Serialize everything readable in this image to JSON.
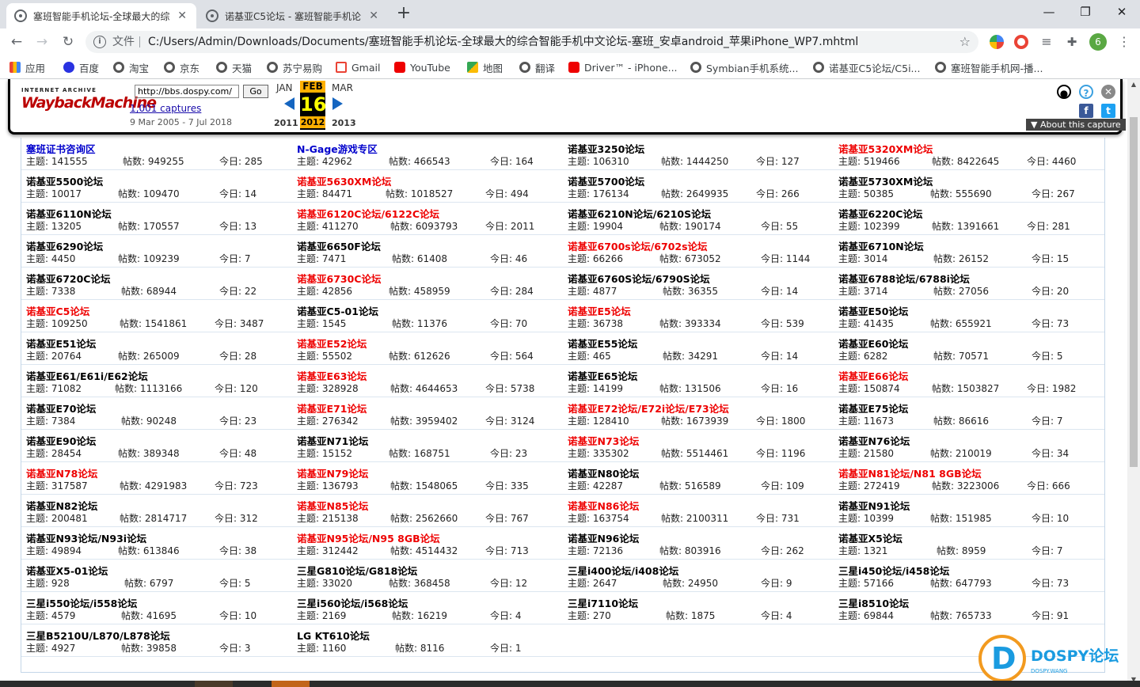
{
  "browser": {
    "tabs": [
      {
        "title": "塞班智能手机论坛-全球最大的综",
        "active": true
      },
      {
        "title": "诺基亚C5论坛 - 塞班智能手机论",
        "active": false
      }
    ],
    "address_prefix": "文件",
    "address": "C:/Users/Admin/Downloads/Documents/塞班智能手机论坛-全球最大的综合智能手机中文论坛-塞班_安卓android_苹果iPhone_WP7.mhtml",
    "profile_initial": "6",
    "bookmarks": [
      "应用",
      "百度",
      "淘宝",
      "京东",
      "天猫",
      "苏宁易购",
      "Gmail",
      "YouTube",
      "地图",
      "翻译",
      "Driver™ - iPhone...",
      "Symbian手机系统...",
      "诺基亚C5论坛/C5i...",
      "塞班智能手机网-播..."
    ]
  },
  "wayback": {
    "logo_top": "INTERNET ARCHIVE",
    "logo_main": "WaybackMachine",
    "url_value": "http://bbs.dospy.com/",
    "go_label": "Go",
    "captures": "1,001 captures",
    "range": "9 Mar 2005 - 7 Jul 2018",
    "prev_month": "JAN",
    "cur_month": "FEB",
    "next_month": "MAR",
    "day": "16",
    "prev_year": "2011",
    "cur_year": "2012",
    "next_year": "2013",
    "about": "▼ About this capture"
  },
  "stat_labels": {
    "topics": "主题:",
    "posts": "帖数:",
    "today": "今日:"
  },
  "forums": [
    [
      {
        "name": "塞班证书咨询区",
        "color": "blue",
        "topics": "141555",
        "posts": "949255",
        "today": "285"
      },
      {
        "name": "N-Gage游戏专区",
        "color": "blue",
        "topics": "42962",
        "posts": "466543",
        "today": "164"
      },
      {
        "name": "诺基亚3250论坛",
        "color": "black",
        "topics": "106310",
        "posts": "1444250",
        "today": "127"
      },
      {
        "name": "诺基亚5320XM论坛",
        "color": "red",
        "topics": "519466",
        "posts": "8422645",
        "today": "4460"
      }
    ],
    [
      {
        "name": "诺基亚5500论坛",
        "color": "black",
        "topics": "10017",
        "posts": "109470",
        "today": "14"
      },
      {
        "name": "诺基亚5630XM论坛",
        "color": "red",
        "topics": "84471",
        "posts": "1018527",
        "today": "494"
      },
      {
        "name": "诺基亚5700论坛",
        "color": "black",
        "topics": "176134",
        "posts": "2649935",
        "today": "266"
      },
      {
        "name": "诺基亚5730XM论坛",
        "color": "black",
        "topics": "50385",
        "posts": "555690",
        "today": "267"
      }
    ],
    [
      {
        "name": "诺基亚6110N论坛",
        "color": "black",
        "topics": "13205",
        "posts": "170557",
        "today": "13"
      },
      {
        "name": "诺基亚6120C论坛/6122C论坛",
        "color": "red",
        "topics": "411270",
        "posts": "6093793",
        "today": "2011"
      },
      {
        "name": "诺基亚6210N论坛/6210S论坛",
        "color": "black",
        "topics": "19904",
        "posts": "190174",
        "today": "55"
      },
      {
        "name": "诺基亚6220C论坛",
        "color": "black",
        "topics": "102399",
        "posts": "1391661",
        "today": "281"
      }
    ],
    [
      {
        "name": "诺基亚6290论坛",
        "color": "black",
        "topics": "4450",
        "posts": "109239",
        "today": "7"
      },
      {
        "name": "诺基亚6650F论坛",
        "color": "black",
        "topics": "7471",
        "posts": "61408",
        "today": "46"
      },
      {
        "name": "诺基亚6700s论坛/6702s论坛",
        "color": "red",
        "topics": "66266",
        "posts": "673052",
        "today": "1144"
      },
      {
        "name": "诺基亚6710N论坛",
        "color": "black",
        "topics": "3014",
        "posts": "26152",
        "today": "15"
      }
    ],
    [
      {
        "name": "诺基亚6720C论坛",
        "color": "black",
        "topics": "7338",
        "posts": "68944",
        "today": "22"
      },
      {
        "name": "诺基亚6730C论坛",
        "color": "red",
        "topics": "42856",
        "posts": "458959",
        "today": "284"
      },
      {
        "name": "诺基亚6760S论坛/6790S论坛",
        "color": "black",
        "topics": "4877",
        "posts": "36355",
        "today": "14"
      },
      {
        "name": "诺基亚6788论坛/6788i论坛",
        "color": "black",
        "topics": "3714",
        "posts": "27056",
        "today": "20"
      }
    ],
    [
      {
        "name": "诺基亚C5论坛",
        "color": "red",
        "topics": "109250",
        "posts": "1541861",
        "today": "3487"
      },
      {
        "name": "诺基亚C5-01论坛",
        "color": "black",
        "topics": "1545",
        "posts": "11376",
        "today": "70"
      },
      {
        "name": "诺基亚E5论坛",
        "color": "red",
        "topics": "36738",
        "posts": "393334",
        "today": "539"
      },
      {
        "name": "诺基亚E50论坛",
        "color": "black",
        "topics": "41435",
        "posts": "655921",
        "today": "73"
      }
    ],
    [
      {
        "name": "诺基亚E51论坛",
        "color": "black",
        "topics": "20764",
        "posts": "265009",
        "today": "28"
      },
      {
        "name": "诺基亚E52论坛",
        "color": "red",
        "topics": "55502",
        "posts": "612626",
        "today": "564"
      },
      {
        "name": "诺基亚E55论坛",
        "color": "black",
        "topics": "465",
        "posts": "34291",
        "today": "14"
      },
      {
        "name": "诺基亚E60论坛",
        "color": "black",
        "topics": "6282",
        "posts": "70571",
        "today": "5"
      }
    ],
    [
      {
        "name": "诺基亚E61/E61i/E62论坛",
        "color": "black",
        "topics": "71082",
        "posts": "1113166",
        "today": "120"
      },
      {
        "name": "诺基亚E63论坛",
        "color": "red",
        "topics": "328928",
        "posts": "4644653",
        "today": "5738"
      },
      {
        "name": "诺基亚E65论坛",
        "color": "black",
        "topics": "14199",
        "posts": "131506",
        "today": "16"
      },
      {
        "name": "诺基亚E66论坛",
        "color": "red",
        "topics": "150874",
        "posts": "1503827",
        "today": "1982"
      }
    ],
    [
      {
        "name": "诺基亚E70论坛",
        "color": "black",
        "topics": "7384",
        "posts": "90248",
        "today": "23"
      },
      {
        "name": "诺基亚E71论坛",
        "color": "red",
        "topics": "276342",
        "posts": "3959402",
        "today": "3124"
      },
      {
        "name": "诺基亚E72论坛/E72i论坛/E73论坛",
        "color": "red",
        "topics": "128410",
        "posts": "1673939",
        "today": "1800"
      },
      {
        "name": "诺基亚E75论坛",
        "color": "black",
        "topics": "11673",
        "posts": "86616",
        "today": "7"
      }
    ],
    [
      {
        "name": "诺基亚E90论坛",
        "color": "black",
        "topics": "28454",
        "posts": "389348",
        "today": "48"
      },
      {
        "name": "诺基亚N71论坛",
        "color": "black",
        "topics": "15152",
        "posts": "168751",
        "today": "23"
      },
      {
        "name": "诺基亚N73论坛",
        "color": "red",
        "topics": "335302",
        "posts": "5514461",
        "today": "1196"
      },
      {
        "name": "诺基亚N76论坛",
        "color": "black",
        "topics": "21580",
        "posts": "210019",
        "today": "34"
      }
    ],
    [
      {
        "name": "诺基亚N78论坛",
        "color": "red",
        "topics": "317587",
        "posts": "4291983",
        "today": "723"
      },
      {
        "name": "诺基亚N79论坛",
        "color": "red",
        "topics": "136793",
        "posts": "1548065",
        "today": "335"
      },
      {
        "name": "诺基亚N80论坛",
        "color": "black",
        "topics": "42287",
        "posts": "516589",
        "today": "109"
      },
      {
        "name": "诺基亚N81论坛/N81 8GB论坛",
        "color": "red",
        "topics": "272419",
        "posts": "3223006",
        "today": "666"
      }
    ],
    [
      {
        "name": "诺基亚N82论坛",
        "color": "black",
        "topics": "200481",
        "posts": "2814717",
        "today": "312"
      },
      {
        "name": "诺基亚N85论坛",
        "color": "red",
        "topics": "215138",
        "posts": "2562660",
        "today": "767"
      },
      {
        "name": "诺基亚N86论坛",
        "color": "red",
        "topics": "163754",
        "posts": "2100311",
        "today": "731"
      },
      {
        "name": "诺基亚N91论坛",
        "color": "black",
        "topics": "10399",
        "posts": "151985",
        "today": "10"
      }
    ],
    [
      {
        "name": "诺基亚N93论坛/N93i论坛",
        "color": "black",
        "topics": "49894",
        "posts": "613846",
        "today": "38"
      },
      {
        "name": "诺基亚N95论坛/N95 8GB论坛",
        "color": "red",
        "topics": "312442",
        "posts": "4514432",
        "today": "713"
      },
      {
        "name": "诺基亚N96论坛",
        "color": "black",
        "topics": "72136",
        "posts": "803916",
        "today": "262"
      },
      {
        "name": "诺基亚X5论坛",
        "color": "black",
        "topics": "1321",
        "posts": "8959",
        "today": "7"
      }
    ],
    [
      {
        "name": "诺基亚X5-01论坛",
        "color": "black",
        "topics": "928",
        "posts": "6797",
        "today": "5"
      },
      {
        "name": "三星G810论坛/G818论坛",
        "color": "black",
        "topics": "33020",
        "posts": "368458",
        "today": "12"
      },
      {
        "name": "三星i400论坛/i408论坛",
        "color": "black",
        "topics": "2647",
        "posts": "24950",
        "today": "9"
      },
      {
        "name": "三星i450论坛/i458论坛",
        "color": "black",
        "topics": "57166",
        "posts": "647793",
        "today": "73"
      }
    ],
    [
      {
        "name": "三星i550论坛/i558论坛",
        "color": "black",
        "topics": "4579",
        "posts": "41695",
        "today": "10"
      },
      {
        "name": "三星i560论坛/i568论坛",
        "color": "black",
        "topics": "2169",
        "posts": "16219",
        "today": "4"
      },
      {
        "name": "三星i7110论坛",
        "color": "black",
        "topics": "270",
        "posts": "1875",
        "today": "4"
      },
      {
        "name": "三星i8510论坛",
        "color": "black",
        "topics": "69844",
        "posts": "765733",
        "today": "91"
      }
    ],
    [
      {
        "name": "三星B5210U/L870/L878论坛",
        "color": "black",
        "topics": "4927",
        "posts": "39858",
        "today": "3"
      },
      {
        "name": "LG KT610论坛",
        "color": "black",
        "topics": "1160",
        "posts": "8116",
        "today": "1"
      }
    ]
  ],
  "watermark": {
    "brand": "DOSPY论坛",
    "sub": "DOSPY.WANG"
  }
}
